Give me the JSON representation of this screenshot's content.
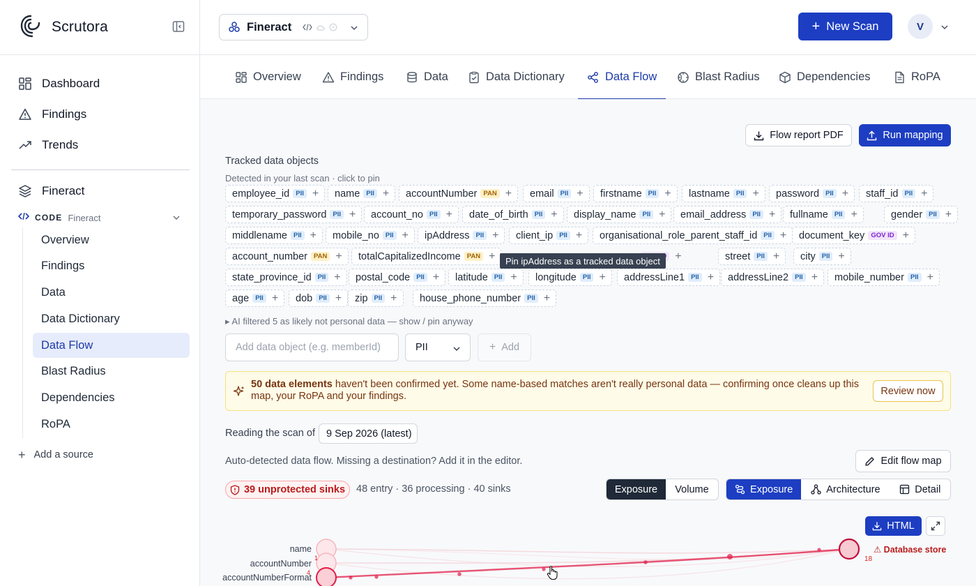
{
  "app": {
    "name": "Scrutora"
  },
  "sidebar": {
    "nav": [
      {
        "label": "Dashboard",
        "icon": "grid-icon"
      },
      {
        "label": "Findings",
        "icon": "warning-triangle-icon"
      },
      {
        "label": "Trends",
        "icon": "trending-up-icon"
      }
    ],
    "project": {
      "label": "Fineract",
      "icon": "layers-icon"
    },
    "source": {
      "type_label": "CODE",
      "name": "Fineract"
    },
    "subnav": [
      {
        "label": "Overview",
        "active": false
      },
      {
        "label": "Findings",
        "active": false
      },
      {
        "label": "Data",
        "active": false
      },
      {
        "label": "Data Dictionary",
        "active": false
      },
      {
        "label": "Data Flow",
        "active": true
      },
      {
        "label": "Blast Radius",
        "active": false
      },
      {
        "label": "Dependencies",
        "active": false
      },
      {
        "label": "RoPA",
        "active": false
      }
    ],
    "add_source": "Add a source"
  },
  "topbar": {
    "project_switcher": "Fineract",
    "new_scan": "New Scan",
    "avatar_initial": "V"
  },
  "tabs": [
    {
      "label": "Overview",
      "icon": "grid-icon"
    },
    {
      "label": "Findings",
      "icon": "warning-triangle-icon"
    },
    {
      "label": "Data",
      "icon": "database-icon"
    },
    {
      "label": "Data Dictionary",
      "icon": "clipboard-check-icon"
    },
    {
      "label": "Data Flow",
      "icon": "share-nodes-icon",
      "active": true
    },
    {
      "label": "Blast Radius",
      "icon": "radius-icon"
    },
    {
      "label": "Dependencies",
      "icon": "package-icon"
    },
    {
      "label": "RoPA",
      "icon": "document-icon"
    }
  ],
  "actions": {
    "flow_report": "Flow report PDF",
    "run_mapping": "Run mapping"
  },
  "tracked": {
    "title": "Tracked data objects",
    "subtitle": "Detected in your last scan · click to pin",
    "chips": [
      {
        "name": "employee_id",
        "tag": "PII"
      },
      {
        "name": "name",
        "tag": "PII"
      },
      {
        "name": "accountNumber",
        "tag": "PAN"
      },
      {
        "name": "email",
        "tag": "PII"
      },
      {
        "name": "firstname",
        "tag": "PII"
      },
      {
        "name": "lastname",
        "tag": "PII"
      },
      {
        "name": "password",
        "tag": "PII"
      },
      {
        "name": "staff_id",
        "tag": "PII"
      },
      {
        "name": "temporary_password",
        "tag": "PII"
      },
      {
        "name": "account_no",
        "tag": "PII"
      },
      {
        "name": "date_of_birth",
        "tag": "PII"
      },
      {
        "name": "display_name",
        "tag": "PII"
      },
      {
        "name": "email_address",
        "tag": "PII"
      },
      {
        "name": "fullname",
        "tag": "PII"
      },
      {
        "name": "gender",
        "tag": "PII"
      },
      {
        "name": "middlename",
        "tag": "PII"
      },
      {
        "name": "mobile_no",
        "tag": "PII"
      },
      {
        "name": "ipAddress",
        "tag": "PII"
      },
      {
        "name": "client_ip",
        "tag": "PII"
      },
      {
        "name": "organisational_role_parent_staff_id",
        "tag": "PII"
      },
      {
        "name": "document_key",
        "tag": "GOV ID"
      },
      {
        "name": "account_number",
        "tag": "PAN"
      },
      {
        "name": "totalCapitalizedIncome",
        "tag": "PAN"
      },
      {
        "name": "",
        "tag": "GOV ID"
      },
      {
        "name": "street",
        "tag": "PII"
      },
      {
        "name": "city",
        "tag": "PII"
      },
      {
        "name": "state_province_id",
        "tag": "PII"
      },
      {
        "name": "postal_code",
        "tag": "PII"
      },
      {
        "name": "latitude",
        "tag": "PII"
      },
      {
        "name": "longitude",
        "tag": "PII"
      },
      {
        "name": "addressLine1",
        "tag": "PII"
      },
      {
        "name": "addressLine2",
        "tag": "PII"
      },
      {
        "name": "mobile_number",
        "tag": "PII"
      },
      {
        "name": "age",
        "tag": "PII"
      },
      {
        "name": "dob",
        "tag": "PII"
      },
      {
        "name": "zip",
        "tag": "PII"
      },
      {
        "name": "house_phone_number",
        "tag": "PII"
      }
    ],
    "tooltip": "Pin ipAddress as a tracked data object",
    "ai_note": "▸ AI filtered 5 as likely not personal data — show / pin anyway",
    "add_placeholder": "Add data object (e.g. memberId)",
    "add_category": "PII",
    "add_button": "Add"
  },
  "banner": {
    "bold": "50 data elements",
    "text": " haven't been confirmed yet. Some name-based matches aren't really personal data — confirming once cleans up this map, your RoPA and your findings.",
    "button": "Review now"
  },
  "scan": {
    "reading_label": "Reading the scan of",
    "date": "9 Sep 2026 (latest)"
  },
  "flow": {
    "auto_note": "Auto-detected data flow. Missing a destination? Add it in the editor.",
    "edit_button": "Edit flow map",
    "unprotected": "39 unprotected sinks",
    "stats": "48 entry · 36 processing · 40 sinks",
    "metric_toggle": [
      {
        "label": "Exposure",
        "on": true
      },
      {
        "label": "Volume",
        "on": false
      }
    ],
    "view_toggle": [
      {
        "label": "Exposure",
        "on": true
      },
      {
        "label": "Architecture",
        "on": false
      },
      {
        "label": "Detail",
        "on": false
      }
    ],
    "export_html": "HTML",
    "nodes": [
      {
        "label": "name",
        "count": ""
      },
      {
        "label": "accountNumber",
        "count": "1"
      },
      {
        "label": "accountNumberFormat",
        "count": "4"
      }
    ],
    "sink": {
      "label": "⚠ Database store",
      "count": "18"
    }
  },
  "colors": {
    "primary": "#1d3ec2",
    "active_nav_bg": "#e6ecfb",
    "danger": "#dc2626",
    "banner_bg": "#fefbe8"
  }
}
